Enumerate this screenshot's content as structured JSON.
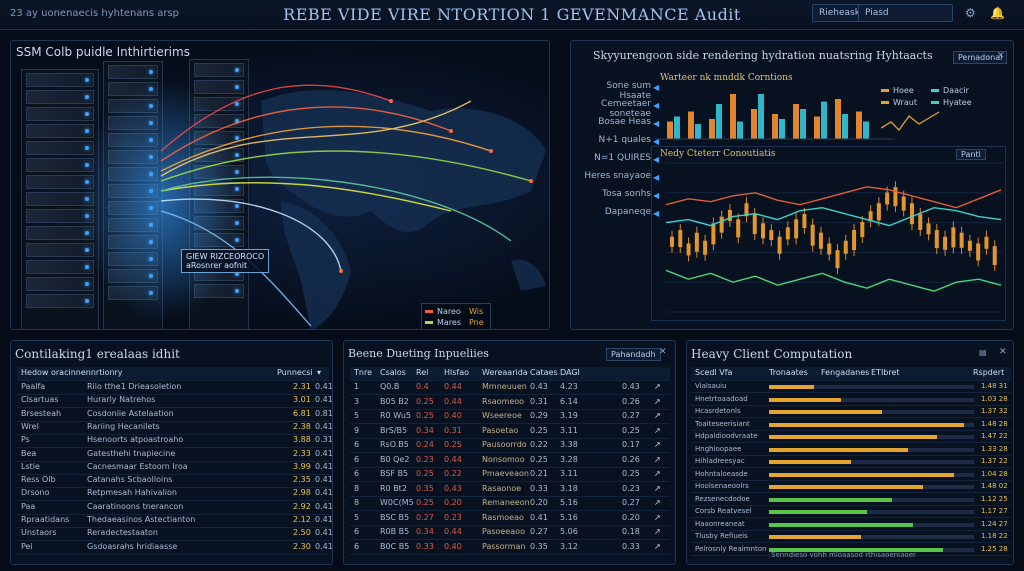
{
  "topbar": {
    "left_text": "23   ay uonenaecis hyhtenans  arsp",
    "title": "REBE VIDE VIRE NTORTION 1 GEVENMANCE Audit",
    "btn1": "Rieheask",
    "btn2": "Piasd",
    "icon1": "settings-icon",
    "icon2": "bell-icon"
  },
  "panel_map": {
    "title": "SSM Colb puidle Inthirtierims",
    "callout_line1": "GIEW RIZCEOROCO",
    "callout_line2": "aRosnrer  aofnit",
    "legend": [
      {
        "label": "Nareo",
        "value": "Wis",
        "color": "#ff5a3c"
      },
      {
        "label": "Mares",
        "value": "Pne",
        "color": "#9ee34a"
      },
      {
        "label": "Miszas",
        "value": "PN",
        "color": "#ffb63c"
      },
      {
        "label": "Ponirl",
        "value": "eXR",
        "color": "#c9e8ff"
      }
    ]
  },
  "panel_perf": {
    "title": "Skyyurengoon side rendering hydration nuatsring Hyhtaacts",
    "badge": "Pemadonal",
    "subtitle1": "Warteer nk mnddk Corntions",
    "subtitle2": "Nedy Cteterr Conoutiatis",
    "left_labels": [
      "Sone sum Hsaate",
      "Cemeetaer soneteae",
      "Bosae Heas",
      "N+1 quales",
      "N=1 QUIRES",
      "Heres snayaoe",
      "Tosa sonhs",
      "Dapaneqe"
    ],
    "right_labels": [
      "Hoee",
      "Daacir",
      "Wraut",
      "Hyatee"
    ],
    "tab": "Pantl",
    "mini_bars_orange": [
      0.35,
      0.55,
      0.4,
      0.9,
      0.6,
      0.5,
      0.7,
      0.45,
      0.8,
      0.55
    ],
    "mini_bars_teal": [
      0.45,
      0.3,
      0.7,
      0.35,
      0.9,
      0.4,
      0.6,
      0.75,
      0.5,
      0.35
    ],
    "candles": [
      0.55,
      0.5,
      0.6,
      0.52,
      0.58,
      0.45,
      0.4,
      0.35,
      0.42,
      0.3,
      0.38,
      0.45,
      0.5,
      0.55,
      0.48,
      0.42,
      0.38,
      0.46,
      0.52,
      0.6,
      0.65,
      0.58,
      0.5,
      0.44,
      0.36,
      0.3,
      0.22,
      0.18,
      0.25,
      0.3,
      0.38,
      0.45,
      0.5,
      0.55,
      0.48,
      0.52,
      0.58,
      0.6,
      0.55,
      0.62
    ],
    "series": [
      {
        "name": "line-a",
        "color": "#e25c3a",
        "values": [
          0.28,
          0.24,
          0.26,
          0.22,
          0.2,
          0.25,
          0.28,
          0.24,
          0.2,
          0.16,
          0.18,
          0.22,
          0.26,
          0.3,
          0.24,
          0.18
        ]
      },
      {
        "name": "line-b",
        "color": "#3fd0c9",
        "values": [
          0.4,
          0.38,
          0.42,
          0.36,
          0.34,
          0.38,
          0.32,
          0.3,
          0.34,
          0.38,
          0.42,
          0.36,
          0.3,
          0.32,
          0.36,
          0.38
        ]
      },
      {
        "name": "line-c",
        "color": "#4bd47a",
        "values": [
          0.72,
          0.78,
          0.74,
          0.8,
          0.76,
          0.82,
          0.78,
          0.74,
          0.8,
          0.84,
          0.78,
          0.82,
          0.86,
          0.8,
          0.78,
          0.82
        ]
      }
    ]
  },
  "panel_content": {
    "title": "Contilaking1 erealaas idhit",
    "header": [
      "Hedow oracinnennrtionry",
      "Punnecsi"
    ],
    "rows": [
      {
        "name": "Paalfa",
        "desc": "Rilo tthe1 Drieasoletion",
        "a": "2.31",
        "b": "0.41"
      },
      {
        "name": "Clsartuas",
        "desc": "Hurarly  Natrehos",
        "a": "3.01",
        "b": "0.41"
      },
      {
        "name": "Brsesteah",
        "desc": "Cosdoniie Astelaation",
        "a": "6.81",
        "b": "0.81"
      },
      {
        "name": "Wrel",
        "desc": "Rariing Hecanilets",
        "a": "2.38",
        "b": "0.41"
      },
      {
        "name": "Ps",
        "desc": "Hsenoorts atpoastroaho",
        "a": "3.88",
        "b": "0.31"
      },
      {
        "name": "Bea",
        "desc": "Gatesthehi tnapiecine",
        "a": "2.33",
        "b": "0.41"
      },
      {
        "name": "Lstie",
        "desc": "Cacnesmaar Estoorn Iroa",
        "a": "3.99",
        "b": "0.41"
      },
      {
        "name": "Ress Olb",
        "desc": "Catanahs Scbaolloins",
        "a": "2.35",
        "b": "0.41"
      },
      {
        "name": "Drsono",
        "desc": "Retpmesah  Hahivalion",
        "a": "2.98",
        "b": "0.41"
      },
      {
        "name": "Paa",
        "desc": "Caaratinoons tnerancon",
        "a": "2.92",
        "b": "0.41"
      },
      {
        "name": "Rpraatidans",
        "desc": "Thedaeasinos Astectianton",
        "a": "2.12",
        "b": "0.41"
      },
      {
        "name": "Unstaors",
        "desc": "Reradectestaaton",
        "a": "2.50",
        "b": "0.41"
      },
      {
        "name": "Pei",
        "desc": "Gsdoasrahs hridiaasse",
        "a": "2.30",
        "b": "0.41"
      }
    ]
  },
  "panel_db": {
    "title": "Beene Dueting Inpueliies",
    "button": "Pahandadh",
    "headers": [
      "Tnre",
      "Csalos",
      "Rel",
      "Hlsfao",
      "Wereaarida",
      "Cataes",
      "DAGI"
    ],
    "rows": [
      {
        "n": "1",
        "a": "Q0.B",
        "b": "0.4",
        "c": "0.44",
        "d": "Mmneuuen",
        "e": "0.43",
        "f": "0.43",
        "g": "4.23"
      },
      {
        "n": "3",
        "a": "B05 B2",
        "b": "0.25",
        "c": "0.44",
        "d": "Rsaomeoo",
        "e": "0.31",
        "f": "0.26",
        "g": "6.14"
      },
      {
        "n": "5",
        "a": "R0 Wu5",
        "b": "0.25",
        "c": "0.40",
        "d": "Wseereoe",
        "e": "0.29",
        "f": "0.27",
        "g": "3.19"
      },
      {
        "n": "9",
        "a": "BrS/B5",
        "b": "0.34",
        "c": "0.31",
        "d": "Pasoetao",
        "e": "0.25",
        "f": "0.25",
        "g": "3.11"
      },
      {
        "n": "6",
        "a": "RsO.B5",
        "b": "0.24",
        "c": "0.25",
        "d": "Pausoorrdo",
        "e": "0.22",
        "f": "0.17",
        "g": "3.38"
      },
      {
        "n": "6",
        "a": "B0 Qe2",
        "b": "0.23",
        "c": "0.44",
        "d": "Nonsomoo",
        "e": "0.25",
        "f": "0.26",
        "g": "3.28"
      },
      {
        "n": "6",
        "a": "BSF B5",
        "b": "0.25",
        "c": "0.22",
        "d": "Pmaeveaon",
        "e": "0.21",
        "f": "0.25",
        "g": "3.11"
      },
      {
        "n": "8",
        "a": "R0 Bt2",
        "b": "0.35",
        "c": "0.43",
        "d": "Rasaonoe",
        "e": "0.33",
        "f": "0.23",
        "g": "3.18"
      },
      {
        "n": "8",
        "a": "W0C(M5",
        "b": "0.25",
        "c": "0.20",
        "d": "Remaneeon",
        "e": "0.20",
        "f": "0.27",
        "g": "5.16"
      },
      {
        "n": "5",
        "a": "BSC B5",
        "b": "0.27",
        "c": "0.23",
        "d": "Rasmoeao",
        "e": "0.41",
        "f": "0.20",
        "g": "5.16"
      },
      {
        "n": "6",
        "a": "R0B B5",
        "b": "0.34",
        "c": "0.44",
        "d": "Pasoeeaoo",
        "e": "0.27",
        "f": "0.18",
        "g": "5.06"
      },
      {
        "n": "6",
        "a": "B0C B5",
        "b": "0.33",
        "c": "0.40",
        "d": "Passorman",
        "e": "0.35",
        "f": "0.33",
        "g": "3.12"
      }
    ]
  },
  "panel_compute": {
    "title": "Heavy Client Computation",
    "headers": [
      "Scedl Vfa",
      "Tronaates",
      "Fengadanes",
      "ETIbret",
      "Rspdert"
    ],
    "rows": [
      {
        "label": "Vialsauiu",
        "v": "1.48 31",
        "fill": 0.22,
        "color": "#e3a431"
      },
      {
        "label": "Hnetrtoaadoad",
        "v": "1.03 28",
        "fill": 0.35,
        "color": "#e3a431"
      },
      {
        "label": "Hcasrdetonls",
        "v": "1.37 32",
        "fill": 0.55,
        "color": "#e3a431"
      },
      {
        "label": "Toaiteseerisiant",
        "v": "1.48 28",
        "fill": 0.95,
        "color": "#e3a431"
      },
      {
        "label": "Hdpaldioodvraate",
        "v": "1.47 22",
        "fill": 0.82,
        "color": "#e3a431"
      },
      {
        "label": "Hnghioopaee",
        "v": "1.33 28",
        "fill": 0.68,
        "color": "#e3a431"
      },
      {
        "label": "Hihladreesyac",
        "v": "1.37 22",
        "fill": 0.4,
        "color": "#e3a431"
      },
      {
        "label": "Hohntaloeasde",
        "v": "1.04 28",
        "fill": 0.9,
        "color": "#e3a431"
      },
      {
        "label": "Hoolsenaeoolrs",
        "v": "1.48 02",
        "fill": 0.75,
        "color": "#e3a431"
      },
      {
        "label": "Rezsenecdodoe",
        "v": "1.12 25",
        "fill": 0.6,
        "color": "#5ac34a"
      },
      {
        "label": "Corsb Reatvesel",
        "v": "1.17 27",
        "fill": 0.48,
        "color": "#5ac34a"
      },
      {
        "label": "Haaonreaneat",
        "v": "1.24 27",
        "fill": 0.7,
        "color": "#5ac34a"
      },
      {
        "label": "Tlusby Refiueis",
        "v": "1.18 22",
        "fill": 0.45,
        "color": "#e3a431"
      },
      {
        "label": "Pelrosnly Reaimntonwe",
        "v": "1.25 28",
        "fill": 0.85,
        "color": "#5ac34a"
      }
    ],
    "footer": "Senndieso    vohh mloaasod rthisaoeniaoer"
  }
}
